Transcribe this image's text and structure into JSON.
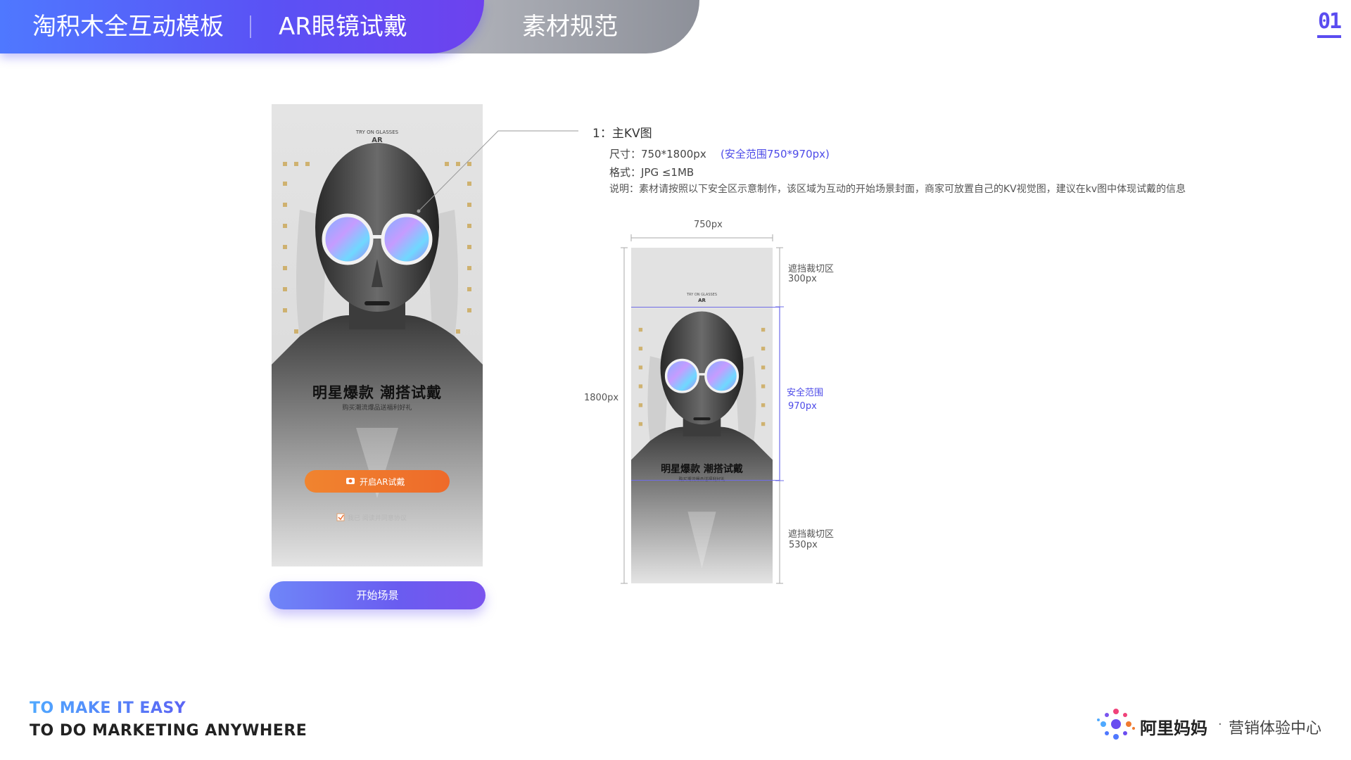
{
  "header": {
    "brand": "淘积木全互动模板",
    "module": "AR眼镜试戴",
    "section": "素材规范",
    "page_number": "01"
  },
  "phone": {
    "try_on_label": "TRY ON GLASSES",
    "ar_label": "AR",
    "headline": "明星爆款  潮搭试戴",
    "subline": "购买潮流爆品送福利好礼",
    "cta_button": "开启AR试戴",
    "agreement": "我已  阅读并同意协议",
    "caption_button": "开始场景"
  },
  "spec": {
    "title": "1：主KV图",
    "size_label": "尺寸：750*1800px",
    "safe_range_note": "(安全范围750*970px)",
    "format_label": "格式：JPG ≤1MB",
    "description": "说明：素材请按照以下安全区示意制作，该区域为互动的开始场景封面，商家可放置自己的KV视觉图，建议在kv图中体现试戴的信息"
  },
  "diagram": {
    "width_label": "750px",
    "height_label": "1800px",
    "top_crop_label": "遮挡裁切区",
    "top_crop_value": "300px",
    "safe_label": "安全范围",
    "safe_value": "970px",
    "bottom_crop_label": "遮挡裁切区",
    "bottom_crop_value": "530px",
    "thumb_try_on": "TRY ON GLASSES",
    "thumb_ar": "AR",
    "thumb_headline": "明星爆款  潮搭试戴",
    "thumb_subline": "购买潮流爆品送福利好礼"
  },
  "footer": {
    "tagline_1": "TO MAKE IT EASY",
    "tagline_2": "TO DO MARKETING ANYWHERE",
    "logo_name": "阿里妈妈",
    "logo_dot": "·",
    "logo_sub": "营销体验中心"
  },
  "colors": {
    "accent": "#5a4cf0",
    "header_blue": "#4f78ff",
    "cta_orange": "#f07a30",
    "safe_line": "#6f6ce8"
  }
}
